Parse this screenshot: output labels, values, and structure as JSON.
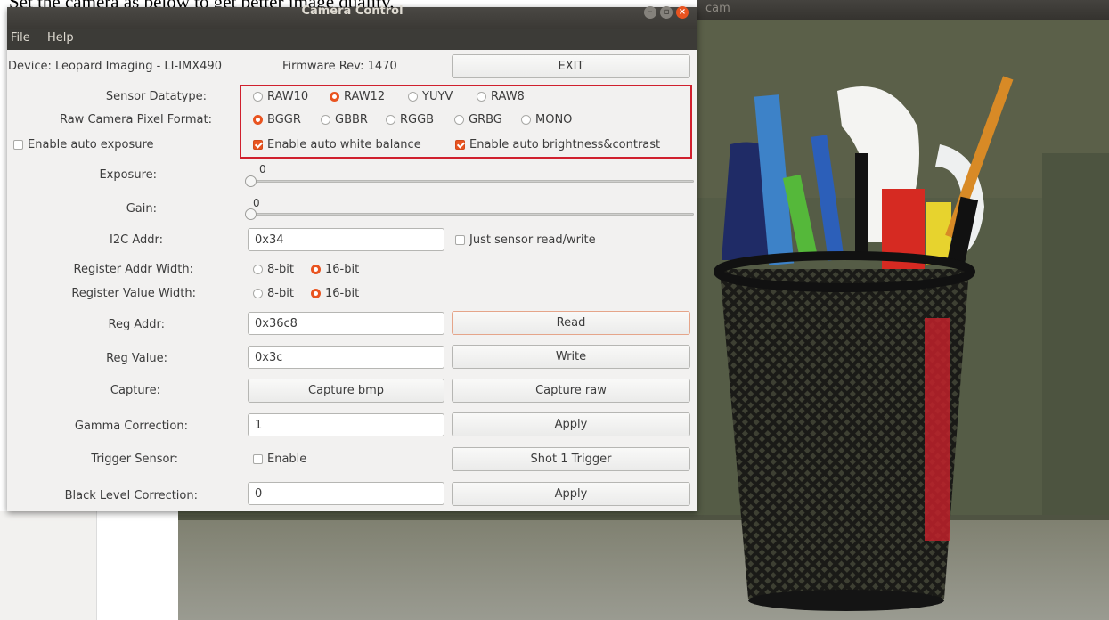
{
  "caption": "Set the camera as below to get better image quality.",
  "cam_window": {
    "title": "cam"
  },
  "dialog": {
    "title": "Camera Control",
    "menu": [
      "File",
      "Help"
    ],
    "device": "Device: Leopard Imaging - LI-IMX490",
    "firmware": "Firmware Rev: 1470",
    "exit_label": "EXIT",
    "sensor_datatype": {
      "label": "Sensor Datatype:",
      "options": [
        "RAW10",
        "RAW12",
        "YUYV",
        "RAW8"
      ],
      "selected": "RAW12"
    },
    "pixel_format": {
      "label": "Raw Camera Pixel Format:",
      "options": [
        "BGGR",
        "GBBR",
        "RGGB",
        "GRBG",
        "MONO"
      ],
      "selected": "BGGR"
    },
    "auto_exposure": {
      "label": "Enable auto exposure",
      "checked": false
    },
    "auto_white_balance": {
      "label": "Enable auto white balance",
      "checked": true
    },
    "auto_brightness": {
      "label": "Enable auto brightness&contrast",
      "checked": true
    },
    "exposure": {
      "label": "Exposure:",
      "value": "0"
    },
    "gain": {
      "label": "Gain:",
      "value": "0"
    },
    "i2c": {
      "label": "I2C Addr:",
      "value": "0x34",
      "just_sensor": "Just sensor read/write",
      "just_sensor_checked": false
    },
    "reg_addr_width": {
      "label": "Register Addr Width:",
      "options": [
        "8-bit",
        "16-bit"
      ],
      "selected": "16-bit"
    },
    "reg_value_width": {
      "label": "Register Value Width:",
      "options": [
        "8-bit",
        "16-bit"
      ],
      "selected": "16-bit"
    },
    "reg_addr": {
      "label": "Reg Addr:",
      "value": "0x36c8",
      "button": "Read"
    },
    "reg_value": {
      "label": "Reg Value:",
      "value": "0x3c",
      "button": "Write"
    },
    "capture": {
      "label": "Capture:",
      "bmp": "Capture bmp",
      "raw": "Capture raw"
    },
    "gamma": {
      "label": "Gamma Correction:",
      "value": "1",
      "button": "Apply"
    },
    "trigger": {
      "label": "Trigger Sensor:",
      "enable": "Enable",
      "enable_checked": false,
      "button": "Shot 1 Trigger"
    },
    "black_level": {
      "label": "Black Level Correction:",
      "value": "0",
      "button": "Apply"
    }
  }
}
